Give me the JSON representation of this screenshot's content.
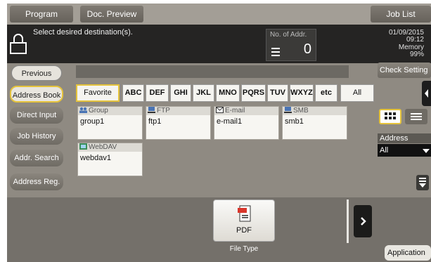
{
  "topbar": {
    "program_label": "Program",
    "doc_preview_label": "Doc. Preview",
    "job_list_label": "Job List"
  },
  "status": {
    "message": "Select desired destination(s).",
    "addr_label": "No. of Addr.",
    "addr_count": "0",
    "date": "01/09/2015",
    "time": "09:12",
    "memory_label": "Memory",
    "memory_value": "99%"
  },
  "nav": {
    "previous_label": "Previous",
    "items": [
      {
        "label": "Address Book"
      },
      {
        "label": "Direct Input"
      },
      {
        "label": "Job History"
      },
      {
        "label": "Addr. Search"
      },
      {
        "label": "Address Reg."
      }
    ]
  },
  "index_tabs": [
    "Favorite",
    "ABC",
    "DEF",
    "GHI",
    "JKL",
    "MNO",
    "PQRS",
    "TUV",
    "WXYZ",
    "etc",
    "All"
  ],
  "destinations": [
    {
      "type": "Group",
      "name": "group1",
      "icon": "group-icon"
    },
    {
      "type": "FTP",
      "name": "ftp1",
      "icon": "ftp-icon"
    },
    {
      "type": "E-mail",
      "name": "e-mail1",
      "icon": "email-icon"
    },
    {
      "type": "SMB",
      "name": "smb1",
      "icon": "smb-icon"
    },
    {
      "type": "WebDAV",
      "name": "webdav1",
      "icon": "webdav-icon"
    }
  ],
  "right_panel": {
    "check_setting_label": "Check Setting",
    "address_label": "Address",
    "address_value": "All"
  },
  "bottom": {
    "file_type_value": "PDF",
    "file_type_caption": "File Type",
    "application_label": "Application"
  },
  "colors": {
    "accent_yellow": "#e5c33b",
    "status_bar": "#252423",
    "panel_gray": "#8f8a82"
  }
}
